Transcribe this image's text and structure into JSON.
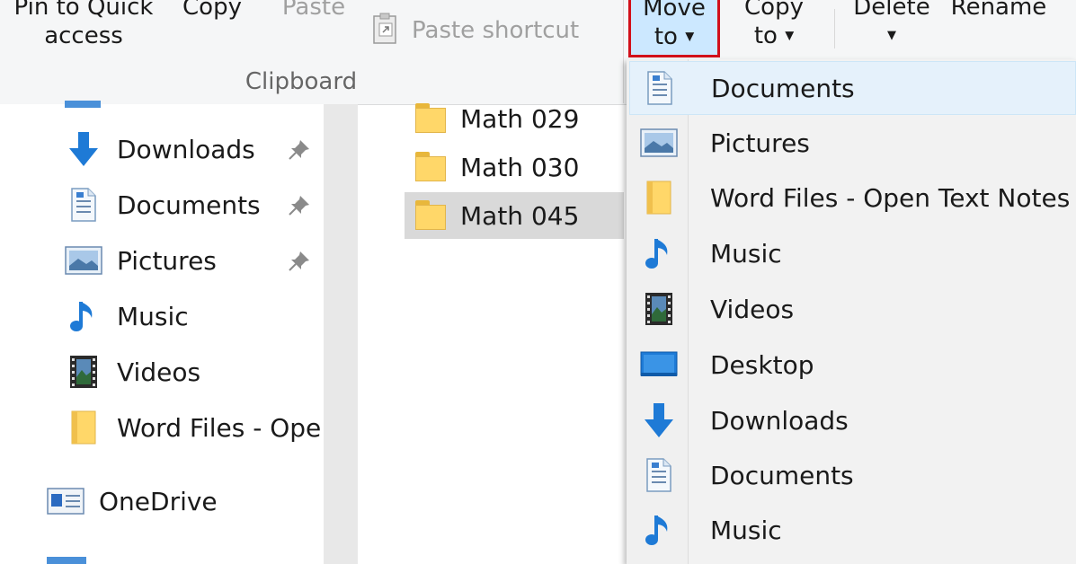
{
  "ribbon": {
    "pin_line1": "Pin to Quick",
    "pin_line2": "access",
    "copy": "Copy",
    "paste": "Paste",
    "paste_shortcut": "Paste shortcut",
    "group_clipboard": "Clipboard",
    "move_line1": "Move",
    "move_line2": "to",
    "copyto_line1": "Copy",
    "copyto_line2": "to",
    "delete": "Delete",
    "rename": "Rename"
  },
  "nav": {
    "items": [
      {
        "label": "Downloads",
        "icon": "downloads-icon",
        "pinned": true
      },
      {
        "label": "Documents",
        "icon": "documents-icon",
        "pinned": true
      },
      {
        "label": "Pictures",
        "icon": "pictures-icon",
        "pinned": true
      },
      {
        "label": "Music",
        "icon": "music-icon",
        "pinned": false
      },
      {
        "label": "Videos",
        "icon": "videos-icon",
        "pinned": false
      },
      {
        "label": "Word Files - Ope",
        "icon": "folder-icon",
        "pinned": false
      }
    ],
    "onedrive": "OneDrive"
  },
  "files": [
    {
      "name": "Math 029",
      "selected": false
    },
    {
      "name": "Math 030",
      "selected": false
    },
    {
      "name": "Math 045",
      "selected": true
    }
  ],
  "menu": {
    "items": [
      {
        "label": "Documents",
        "icon": "documents-icon",
        "hover": true
      },
      {
        "label": "Pictures",
        "icon": "pictures-icon"
      },
      {
        "label": "Word Files - Open Text Notes",
        "icon": "folder-icon"
      },
      {
        "label": "Music",
        "icon": "music-icon"
      },
      {
        "label": "Videos",
        "icon": "videos-icon"
      },
      {
        "label": "Desktop",
        "icon": "desktop-icon"
      },
      {
        "label": "Downloads",
        "icon": "downloads-icon"
      },
      {
        "label": "Documents",
        "icon": "documents-icon"
      },
      {
        "label": "Music",
        "icon": "music-icon"
      }
    ]
  },
  "colors": {
    "accent": "#0078d7",
    "highlight_border": "#d2101a",
    "selection": "#cce8ff"
  }
}
